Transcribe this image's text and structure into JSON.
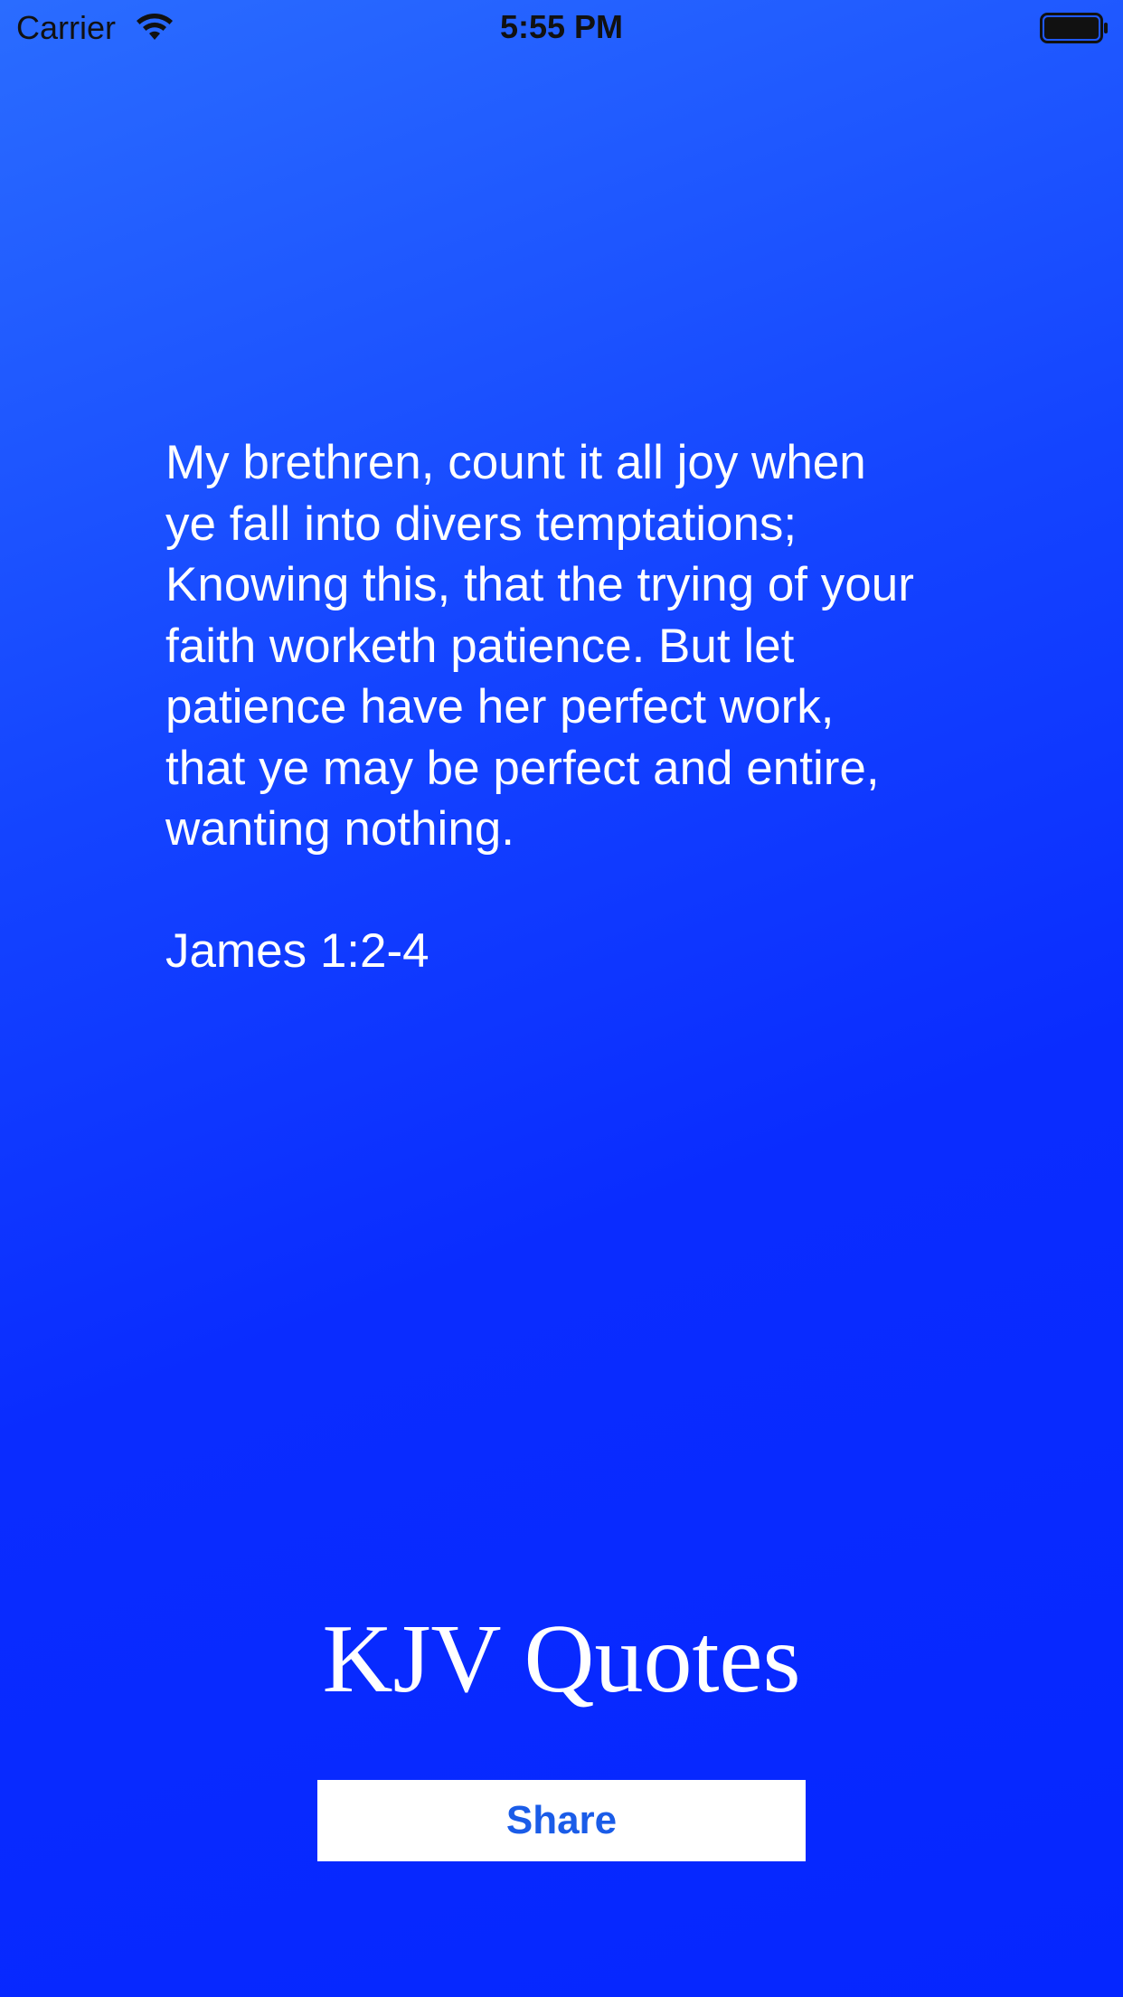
{
  "status_bar": {
    "carrier": "Carrier",
    "time": "5:55 PM",
    "wifi_icon": "wifi-icon",
    "battery_icon": "battery-icon"
  },
  "quote": {
    "text": "My brethren, count it all joy when\nye fall into divers temptations;\nKnowing this, that the trying of your\nfaith worketh patience.  But let\npatience have her perfect work,\nthat ye may be perfect and entire,\nwanting nothing.",
    "reference": "James 1:2-4"
  },
  "app": {
    "title": "KJV Quotes"
  },
  "actions": {
    "share_label": "Share"
  },
  "colors": {
    "background_top": "#2a6cff",
    "background_bottom": "#0526ff",
    "button_background": "#ffffff",
    "button_text": "#1a5ce8",
    "text": "#ffffff"
  }
}
